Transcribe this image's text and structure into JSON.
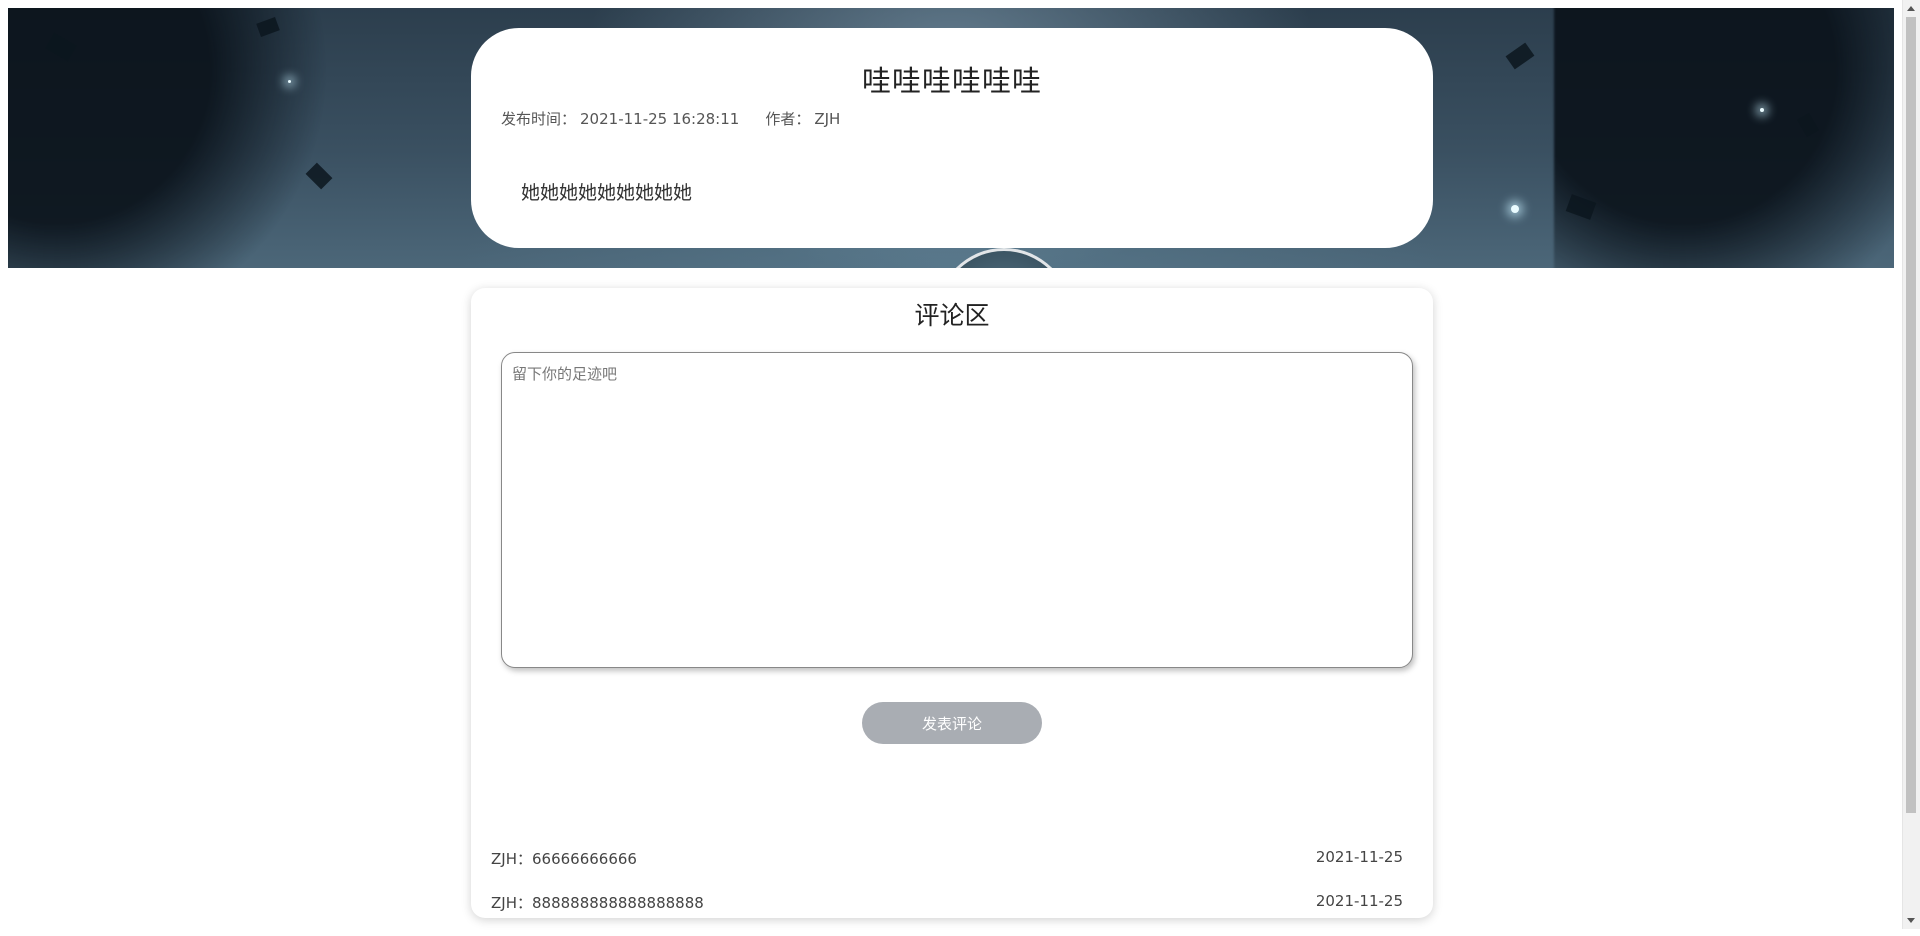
{
  "article": {
    "title": "哇哇哇哇哇哇",
    "publish_label": "发布时间：",
    "publish_time": "2021-11-25 16:28:11",
    "author_label": "作者：",
    "author": "ZJH",
    "body": "她她她她她她她她她"
  },
  "comments_section": {
    "heading": "评论区",
    "input_placeholder": "留下你的足迹吧",
    "input_value": "",
    "submit_label": "发表评论",
    "items": [
      {
        "user": "ZJH",
        "separator": "：",
        "text": "66666666666",
        "date": "2021-11-25"
      },
      {
        "user": "ZJH",
        "separator": "：",
        "text": "888888888888888888",
        "date": "2021-11-25"
      }
    ]
  },
  "colors": {
    "submit_button_bg": "#a9adb3",
    "page_bg": "#ffffff",
    "hero_bg": "#3a5061"
  },
  "icons": {
    "scroll_up": "scroll-up-arrow-icon",
    "scroll_down": "scroll-down-arrow-icon"
  }
}
